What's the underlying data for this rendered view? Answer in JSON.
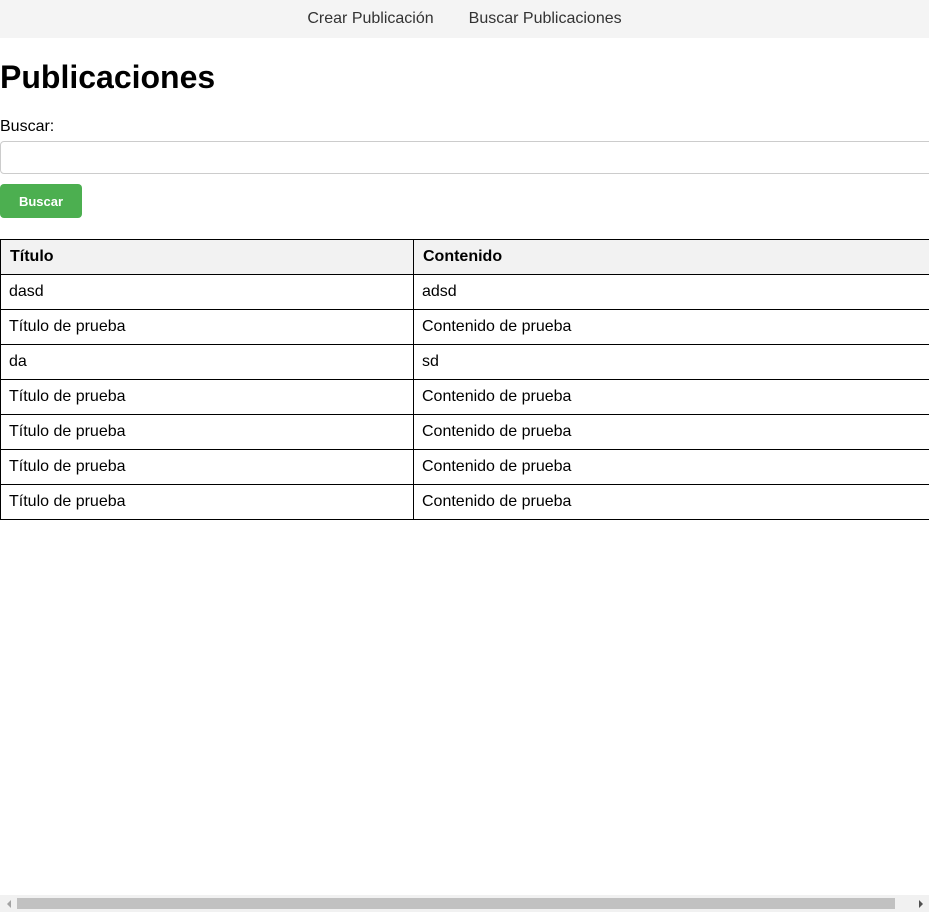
{
  "nav": {
    "items": [
      {
        "label": "Crear Publicación"
      },
      {
        "label": "Buscar Publicaciones"
      }
    ]
  },
  "page": {
    "title": "Publicaciones"
  },
  "search": {
    "label": "Buscar:",
    "value": "",
    "button_label": "Buscar"
  },
  "table": {
    "columns": [
      "Título",
      "Contenido"
    ],
    "rows": [
      {
        "titulo": "dasd",
        "contenido": "adsd"
      },
      {
        "titulo": "Título de prueba",
        "contenido": "Contenido de prueba"
      },
      {
        "titulo": "da",
        "contenido": "sd"
      },
      {
        "titulo": "Título de prueba",
        "contenido": "Contenido de prueba"
      },
      {
        "titulo": "Título de prueba",
        "contenido": "Contenido de prueba"
      },
      {
        "titulo": "Título de prueba",
        "contenido": "Contenido de prueba"
      },
      {
        "titulo": "Título de prueba",
        "contenido": "Contenido de prueba"
      }
    ]
  },
  "colors": {
    "nav_bg": "#f4f4f4",
    "button_bg": "#4caf50",
    "header_bg": "#f2f2f2"
  },
  "icons": {
    "scroll_left": "chevron-left-icon",
    "scroll_right": "chevron-right-icon"
  }
}
